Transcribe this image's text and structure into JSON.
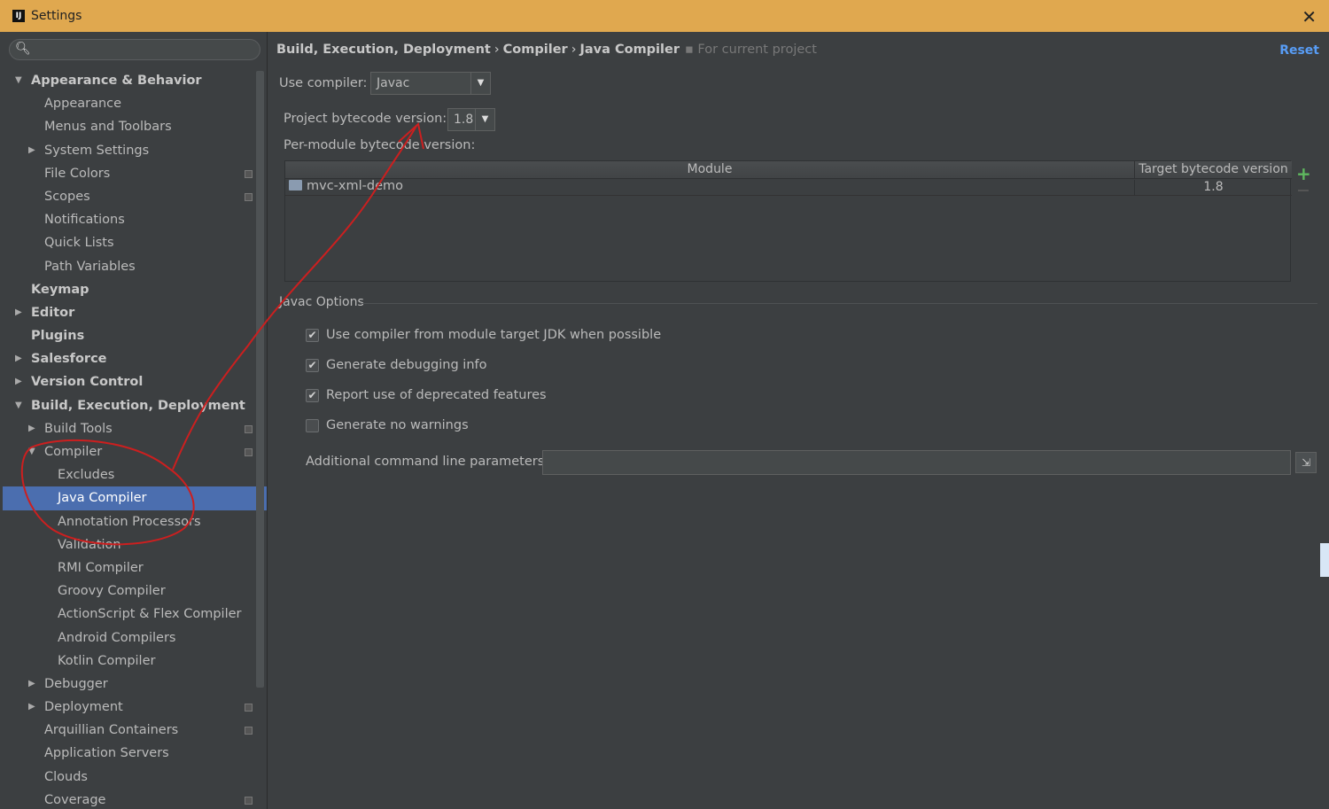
{
  "window": {
    "title": "Settings",
    "icon": "intellij-icon"
  },
  "search": {
    "placeholder": ""
  },
  "tree": [
    {
      "label": "Appearance & Behavior",
      "level": 0,
      "bold": true,
      "arrow": "expanded"
    },
    {
      "label": "Appearance",
      "level": 1
    },
    {
      "label": "Menus and Toolbars",
      "level": 1
    },
    {
      "label": "System Settings",
      "level": 1,
      "arrow": "collapsed"
    },
    {
      "label": "File Colors",
      "level": 1,
      "project": true
    },
    {
      "label": "Scopes",
      "level": 1,
      "project": true
    },
    {
      "label": "Notifications",
      "level": 1
    },
    {
      "label": "Quick Lists",
      "level": 1
    },
    {
      "label": "Path Variables",
      "level": 1
    },
    {
      "label": "Keymap",
      "level": 0,
      "bold": true
    },
    {
      "label": "Editor",
      "level": 0,
      "bold": true,
      "arrow": "collapsed"
    },
    {
      "label": "Plugins",
      "level": 0,
      "bold": true
    },
    {
      "label": "Salesforce",
      "level": 0,
      "bold": true,
      "arrow": "collapsed"
    },
    {
      "label": "Version Control",
      "level": 0,
      "bold": true,
      "arrow": "collapsed"
    },
    {
      "label": "Build, Execution, Deployment",
      "level": 0,
      "bold": true,
      "arrow": "expanded"
    },
    {
      "label": "Build Tools",
      "level": 1,
      "arrow": "collapsed",
      "project": true
    },
    {
      "label": "Compiler",
      "level": 1,
      "arrow": "expanded",
      "project": true
    },
    {
      "label": "Excludes",
      "level": 2
    },
    {
      "label": "Java Compiler",
      "level": 2,
      "selected": true
    },
    {
      "label": "Annotation Processors",
      "level": 2
    },
    {
      "label": "Validation",
      "level": 2
    },
    {
      "label": "RMI Compiler",
      "level": 2
    },
    {
      "label": "Groovy Compiler",
      "level": 2
    },
    {
      "label": "ActionScript & Flex Compiler",
      "level": 2
    },
    {
      "label": "Android Compilers",
      "level": 2
    },
    {
      "label": "Kotlin Compiler",
      "level": 2
    },
    {
      "label": "Debugger",
      "level": 1,
      "arrow": "collapsed"
    },
    {
      "label": "Deployment",
      "level": 1,
      "arrow": "collapsed",
      "project": true
    },
    {
      "label": "Arquillian Containers",
      "level": 1,
      "project": true
    },
    {
      "label": "Application Servers",
      "level": 1
    },
    {
      "label": "Clouds",
      "level": 1
    },
    {
      "label": "Coverage",
      "level": 1,
      "project": true
    }
  ],
  "breadcrumb": {
    "parts": [
      "Build, Execution, Deployment",
      "Compiler",
      "Java Compiler"
    ],
    "separator": "›",
    "scope": "For current project"
  },
  "reset_label": "Reset",
  "compiler": {
    "label": "Use compiler:",
    "value": "Javac"
  },
  "bytecode": {
    "label": "Project bytecode version:",
    "value": "1.8"
  },
  "per_module": {
    "label": "Per-module bytecode version:",
    "col_module": "Module",
    "col_target": "Target bytecode version",
    "rows": [
      {
        "module": "mvc-xml-demo",
        "target": "1.8"
      }
    ]
  },
  "javac": {
    "section": "Javac Options",
    "options": [
      {
        "label": "Use compiler from module target JDK when possible",
        "checked": true
      },
      {
        "label": "Generate debugging info",
        "checked": true
      },
      {
        "label": "Report use of deprecated features",
        "checked": true
      },
      {
        "label": "Generate no warnings",
        "checked": false
      }
    ],
    "params_label": "Additional command line parameters:",
    "params_value": ""
  },
  "colors": {
    "titlebar": "#e0a84f",
    "background": "#3c3f41",
    "selection": "#4b6eaf",
    "link": "#589df6",
    "annotation": "#cc1f1f"
  }
}
